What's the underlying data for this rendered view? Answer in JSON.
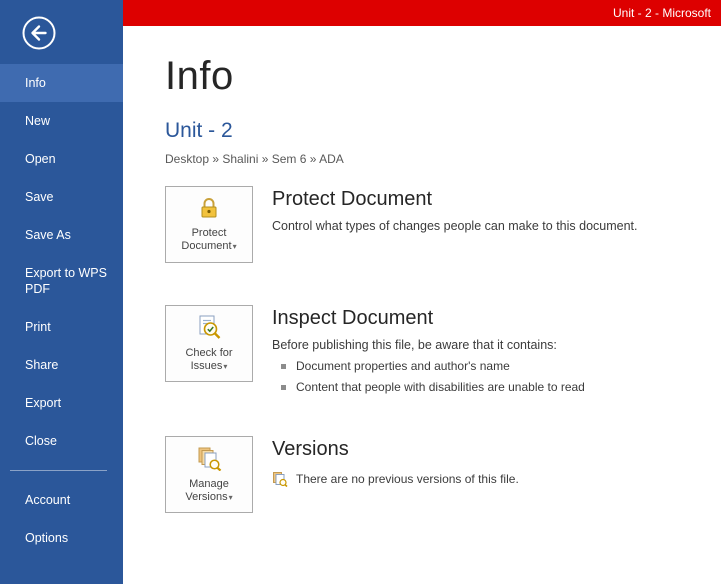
{
  "titlebar": {
    "title": "Unit - 2 - Microsoft"
  },
  "colors": {
    "sidebar_blue": "#2b579a",
    "active_item_blue": "#3f6bb0",
    "titlebar_red": "#dd0000",
    "doc_title_blue": "#2b579a"
  },
  "glyphs": {
    "caret": "▾"
  },
  "sidebar": {
    "items": [
      {
        "label": "Info"
      },
      {
        "label": "New"
      },
      {
        "label": "Open"
      },
      {
        "label": "Save"
      },
      {
        "label": "Save As"
      },
      {
        "label": "Export to WPS PDF"
      },
      {
        "label": "Print"
      },
      {
        "label": "Share"
      },
      {
        "label": "Export"
      },
      {
        "label": "Close"
      },
      {
        "label": "Account"
      },
      {
        "label": "Options"
      }
    ]
  },
  "main": {
    "page_title": "Info",
    "doc_title": "Unit - 2",
    "breadcrumb": "Desktop » Shalini » Sem 6 » ADA",
    "sections": [
      {
        "button_line1": "Protect",
        "button_line2": "Document",
        "title": "Protect Document",
        "description": "Control what types of changes people can make to this document."
      },
      {
        "button_line1": "Check for",
        "button_line2": "Issues",
        "title": "Inspect Document",
        "description": "Before publishing this file, be aware that it contains:",
        "bullets": [
          "Document properties and author's name",
          "Content that people with disabilities are unable to read"
        ]
      },
      {
        "button_line1": "Manage",
        "button_line2": "Versions",
        "title": "Versions",
        "note": "There are no previous versions of this file."
      }
    ]
  }
}
